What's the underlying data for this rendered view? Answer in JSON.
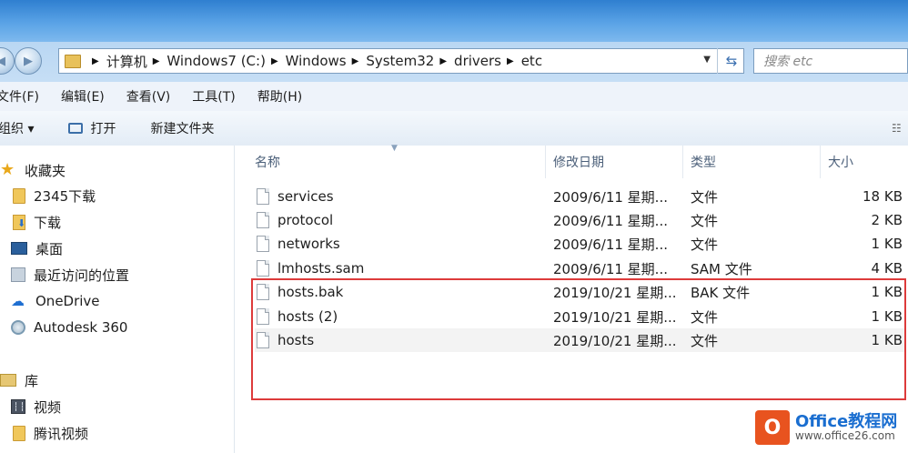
{
  "address": {
    "crumbs": [
      "计算机",
      "Windows7 (C:)",
      "Windows",
      "System32",
      "drivers",
      "etc"
    ]
  },
  "search": {
    "placeholder": "搜索 etc"
  },
  "menu": [
    "文件(F)",
    "编辑(E)",
    "查看(V)",
    "工具(T)",
    "帮助(H)"
  ],
  "toolbar": {
    "organize": "组织 ▾",
    "open": "打开",
    "new_folder": "新建文件夹"
  },
  "nav": {
    "favorites": "收藏夹",
    "fav_items": [
      "2345下载",
      "下载",
      "桌面",
      "最近访问的位置"
    ],
    "onedrive": "OneDrive",
    "autodesk": "Autodesk 360",
    "library": "库",
    "lib_items": [
      "视频",
      "腾讯视频"
    ]
  },
  "columns": {
    "name": "名称",
    "date": "修改日期",
    "type": "类型",
    "size": "大小"
  },
  "files": [
    {
      "name": "services",
      "date": "2009/6/11 星期...",
      "type": "文件",
      "size": "18 KB"
    },
    {
      "name": "protocol",
      "date": "2009/6/11 星期...",
      "type": "文件",
      "size": "2 KB"
    },
    {
      "name": "networks",
      "date": "2009/6/11 星期...",
      "type": "文件",
      "size": "1 KB"
    },
    {
      "name": "lmhosts.sam",
      "date": "2009/6/11 星期...",
      "type": "SAM 文件",
      "size": "4 KB"
    },
    {
      "name": "hosts.bak",
      "date": "2019/10/21 星期...",
      "type": "BAK 文件",
      "size": "1 KB"
    },
    {
      "name": "hosts (2)",
      "date": "2019/10/21 星期...",
      "type": "文件",
      "size": "1 KB"
    },
    {
      "name": "hosts",
      "date": "2019/10/21 星期...",
      "type": "文件",
      "size": "1 KB"
    }
  ],
  "watermark": {
    "line1": "Office教程网",
    "line2": "www.office26.com"
  },
  "colors": {
    "highlight": "#dd3b3b",
    "accent": "#1a6ed0",
    "brand_orange": "#e8531f"
  }
}
